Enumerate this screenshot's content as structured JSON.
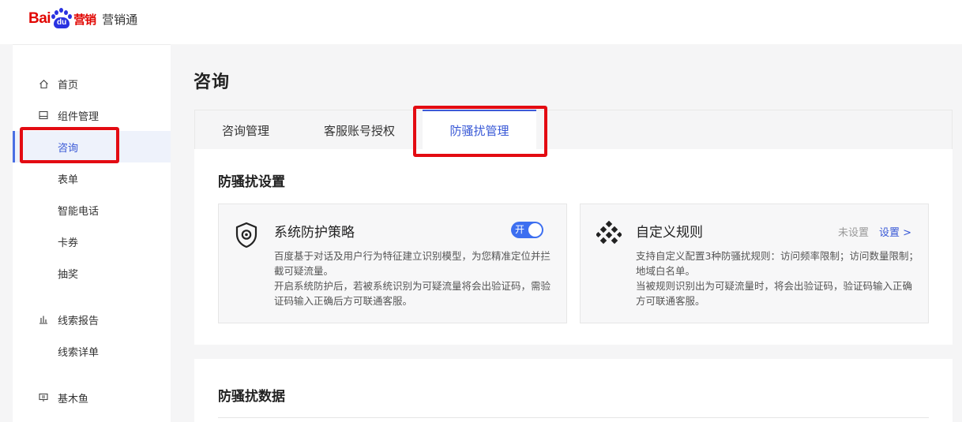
{
  "brand": {
    "logo_latin": "Bai",
    "logo_paw_text": "du",
    "logo_cn": "营销",
    "product_name": "营销通"
  },
  "sidebar": {
    "items": [
      {
        "label": "首页",
        "icon": "home-icon"
      },
      {
        "label": "组件管理",
        "icon": "component-icon"
      },
      {
        "label": "咨询",
        "active": true
      },
      {
        "label": "表单"
      },
      {
        "label": "智能电话"
      },
      {
        "label": "卡券"
      },
      {
        "label": "抽奖"
      },
      {
        "label": "线索报告",
        "icon": "bar-chart-icon"
      },
      {
        "label": "线索详单"
      },
      {
        "label": "基木鱼",
        "icon": "monitor-icon"
      }
    ]
  },
  "main": {
    "page_title": "咨询",
    "tabs": [
      {
        "label": "咨询管理"
      },
      {
        "label": "客服账号授权"
      },
      {
        "label": "防骚扰管理",
        "active": true
      }
    ],
    "settings_section": {
      "title": "防骚扰设置",
      "system_policy": {
        "title": "系统防护策略",
        "toggle_label": "开",
        "toggle_on": true,
        "desc_line1": "百度基于对话及用户行为特征建立识别模型，为您精准定位并拦截可疑流量。",
        "desc_line2": "开启系统防护后，若被系统识别为可疑流量将会出验证码，需验证码输入正确后方可联通客服。"
      },
      "custom_rules": {
        "title": "自定义规则",
        "status": "未设置",
        "setting_link": "设置 >",
        "desc_line1": "支持自定义配置3种防骚扰规则：访问频率限制；访问数量限制；地域白名单。",
        "desc_line2": "当被规则识别出为可疑流量时，将会出验证码，验证码输入正确方可联通客服。"
      }
    },
    "data_section": {
      "title": "防骚扰数据"
    }
  },
  "colors": {
    "accent": "#3858d6",
    "toggle_on": "#3d6ff0",
    "highlight": "#e30b12",
    "brand_red": "#e10602",
    "brand_blue": "#2932e1"
  }
}
